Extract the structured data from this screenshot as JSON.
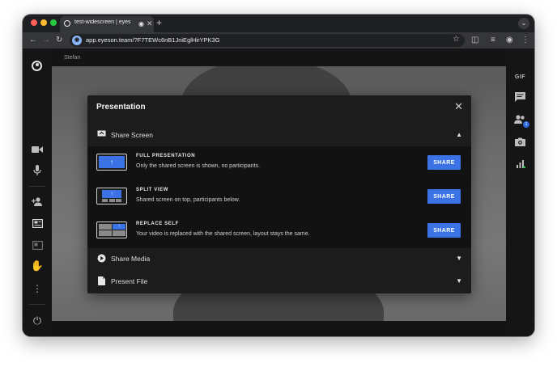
{
  "browser": {
    "tab_title": "test-widescreen | eyes",
    "url": "app.eyeson.team/?F7TEWc6nB1JniEglHirYPK3G",
    "icons": [
      "speaker-icon",
      "close-icon",
      "plus-icon",
      "chevron-down-icon",
      "back-arrow-icon",
      "forward-arrow-icon",
      "reload-icon",
      "star-icon",
      "extensions-icon",
      "media-icon",
      "profile-icon",
      "menu-icon"
    ]
  },
  "stage": {
    "participant_name": "Stefan"
  },
  "right_sidebar": {
    "gif_label": "GIF",
    "participants_badge": "1"
  },
  "modal": {
    "title": "Presentation",
    "sections": {
      "share_screen": "Share Screen",
      "share_media": "Share Media",
      "present_file": "Present File"
    },
    "options": [
      {
        "title": "FULL PRESENTATION",
        "desc": "Only the shared screen is shown, no participants.",
        "button": "SHARE"
      },
      {
        "title": "SPLIT VIEW",
        "desc": "Shared screen on top, participants below.",
        "button": "SHARE"
      },
      {
        "title": "REPLACE SELF",
        "desc": "Your video is replaced with the shared screen, layout stays the same.",
        "button": "SHARE"
      }
    ]
  },
  "colors": {
    "accent": "#3b73e6",
    "modal_bg": "#1c1c1c",
    "sidebar_bg": "#151515"
  }
}
